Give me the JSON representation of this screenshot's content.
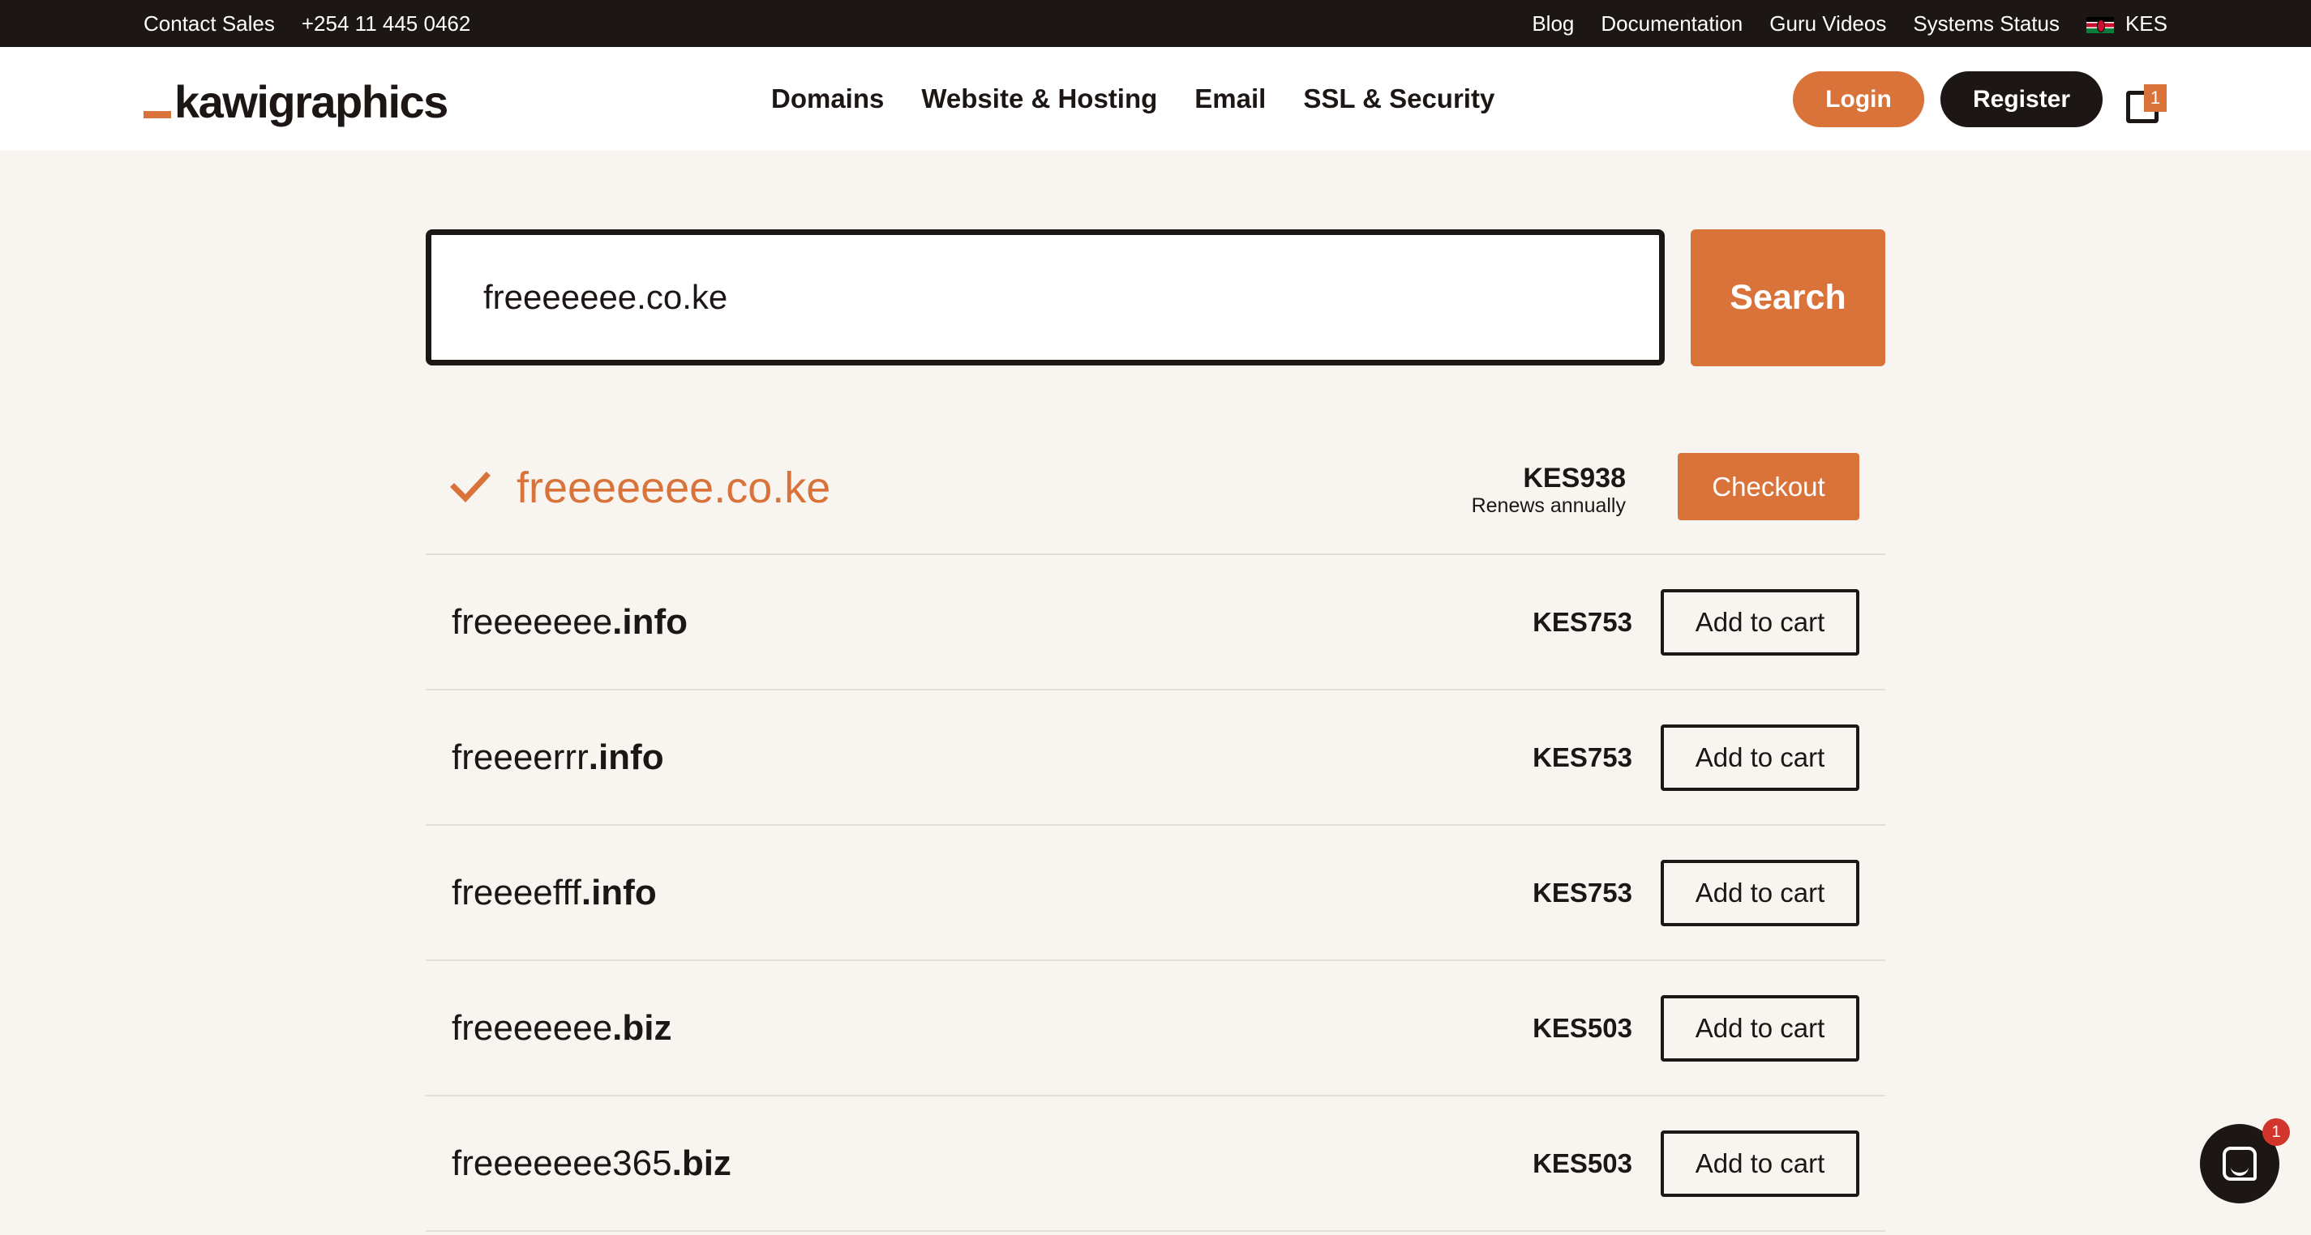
{
  "topbar": {
    "contact_sales": "Contact Sales",
    "phone": "+254 11 445 0462",
    "links": [
      "Blog",
      "Documentation",
      "Guru Videos",
      "Systems Status"
    ],
    "currency": "KES"
  },
  "header": {
    "logo": "kawigraphics",
    "nav": [
      "Domains",
      "Website & Hosting",
      "Email",
      "SSL & Security"
    ],
    "login": "Login",
    "register": "Register",
    "cart_count": "1"
  },
  "search": {
    "value": "freeeeeee.co.ke",
    "button": "Search"
  },
  "primary_result": {
    "domain": "freeeeeee.co.ke",
    "price": "KES938",
    "renewal": "Renews annually",
    "button": "Checkout"
  },
  "results": [
    {
      "name": "freeeeeee",
      "tld": ".info",
      "price": "KES753",
      "button": "Add to cart"
    },
    {
      "name": "freeeerrr",
      "tld": ".info",
      "price": "KES753",
      "button": "Add to cart"
    },
    {
      "name": "freeeefff",
      "tld": ".info",
      "price": "KES753",
      "button": "Add to cart"
    },
    {
      "name": "freeeeeee",
      "tld": ".biz",
      "price": "KES503",
      "button": "Add to cart"
    },
    {
      "name": "freeeeeee365",
      "tld": ".biz",
      "price": "KES503",
      "button": "Add to cart"
    }
  ],
  "chat": {
    "badge": "1"
  },
  "colors": {
    "accent": "#d9733a",
    "dark": "#1c1614",
    "background": "#f8f5f0"
  }
}
